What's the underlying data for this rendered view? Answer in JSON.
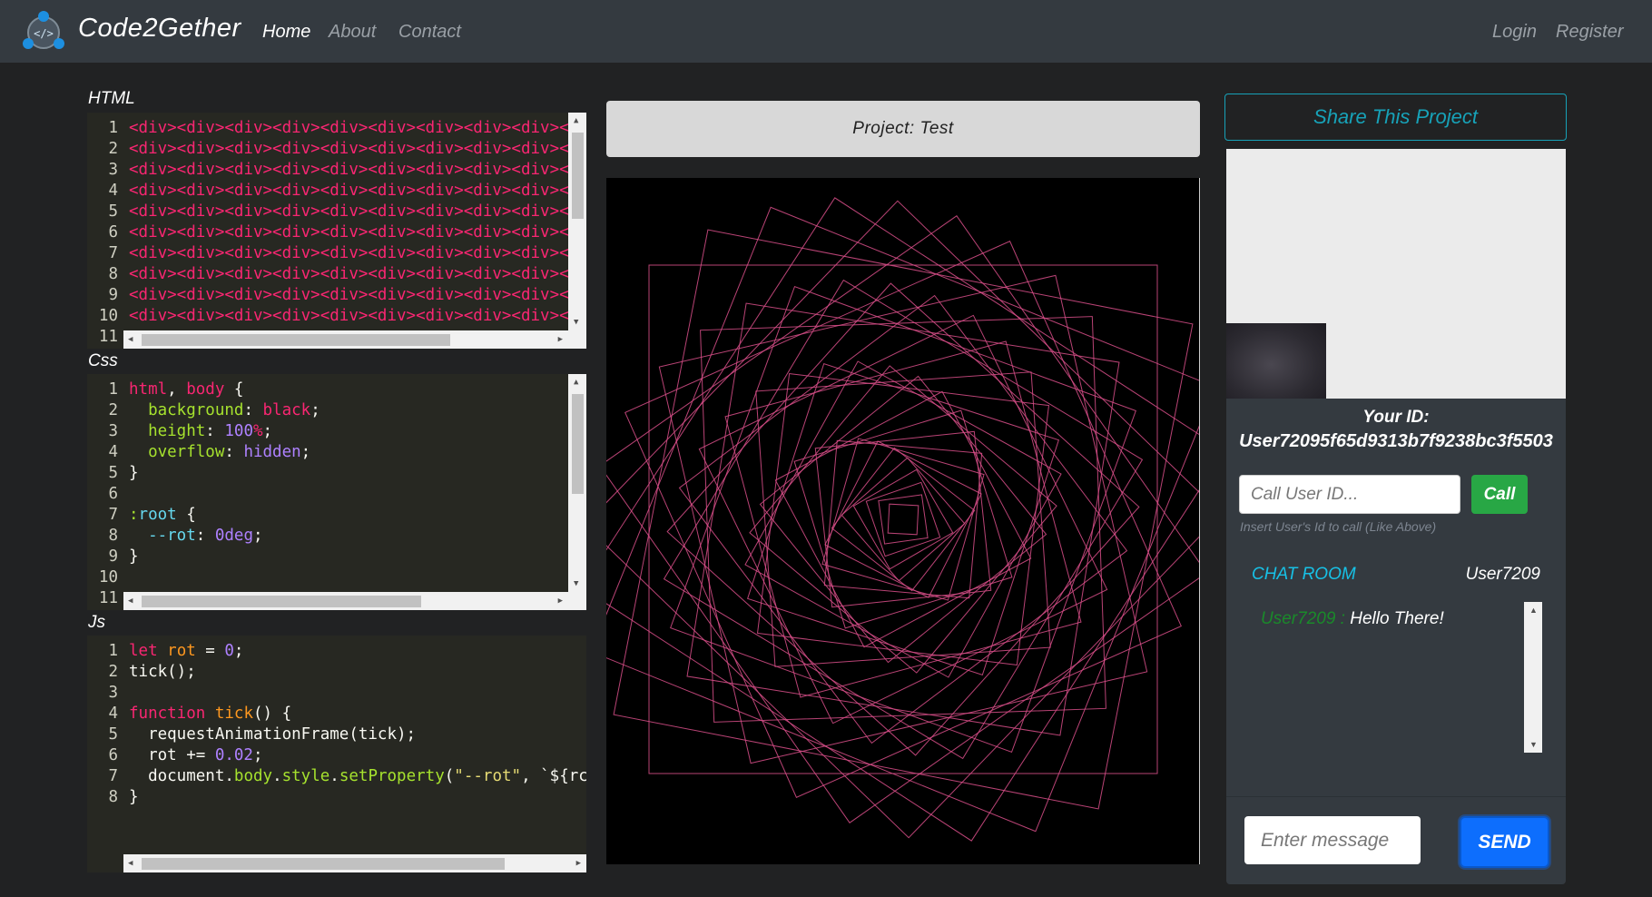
{
  "navbar": {
    "brand": "Code2Gether",
    "links": [
      "Home",
      "About",
      "Contact"
    ],
    "auth": [
      "Login",
      "Register"
    ]
  },
  "editors": {
    "html": {
      "label": "HTML",
      "line_numbers": [
        "1",
        "2",
        "3",
        "4",
        "5",
        "6",
        "7",
        "8",
        "9",
        "10",
        "11"
      ],
      "line_text": "<div><div><div><div><div><div><div><div><div><div><div>"
    },
    "css": {
      "label": "Css",
      "line_numbers": [
        "1",
        "2",
        "3",
        "4",
        "5",
        "6",
        "7",
        "8",
        "9",
        "10",
        "11"
      ]
    },
    "js": {
      "label": "Js",
      "line_numbers": [
        "1",
        "2",
        "3",
        "4",
        "5",
        "6",
        "7",
        "8"
      ]
    }
  },
  "project": {
    "title": "Project: Test"
  },
  "share": {
    "label": "Share This Project"
  },
  "identity": {
    "label": "Your ID:",
    "value": "User72095f65d9313b7f9238bc3f5503"
  },
  "call": {
    "placeholder": "Call User ID...",
    "button": "Call",
    "help": "Insert User's Id to call (Like Above)"
  },
  "chat": {
    "title": "CHAT ROOM",
    "user": "User7209",
    "messages": [
      {
        "sender": "User7209 :",
        "text": "Hello There!"
      }
    ],
    "input_placeholder": "Enter message",
    "send": "SEND"
  },
  "colors": {
    "navbar": "#343a40",
    "accent": "#17a2b8",
    "call": "#28a745",
    "send": "#0d6efd",
    "spiral": "#d94f8a"
  }
}
